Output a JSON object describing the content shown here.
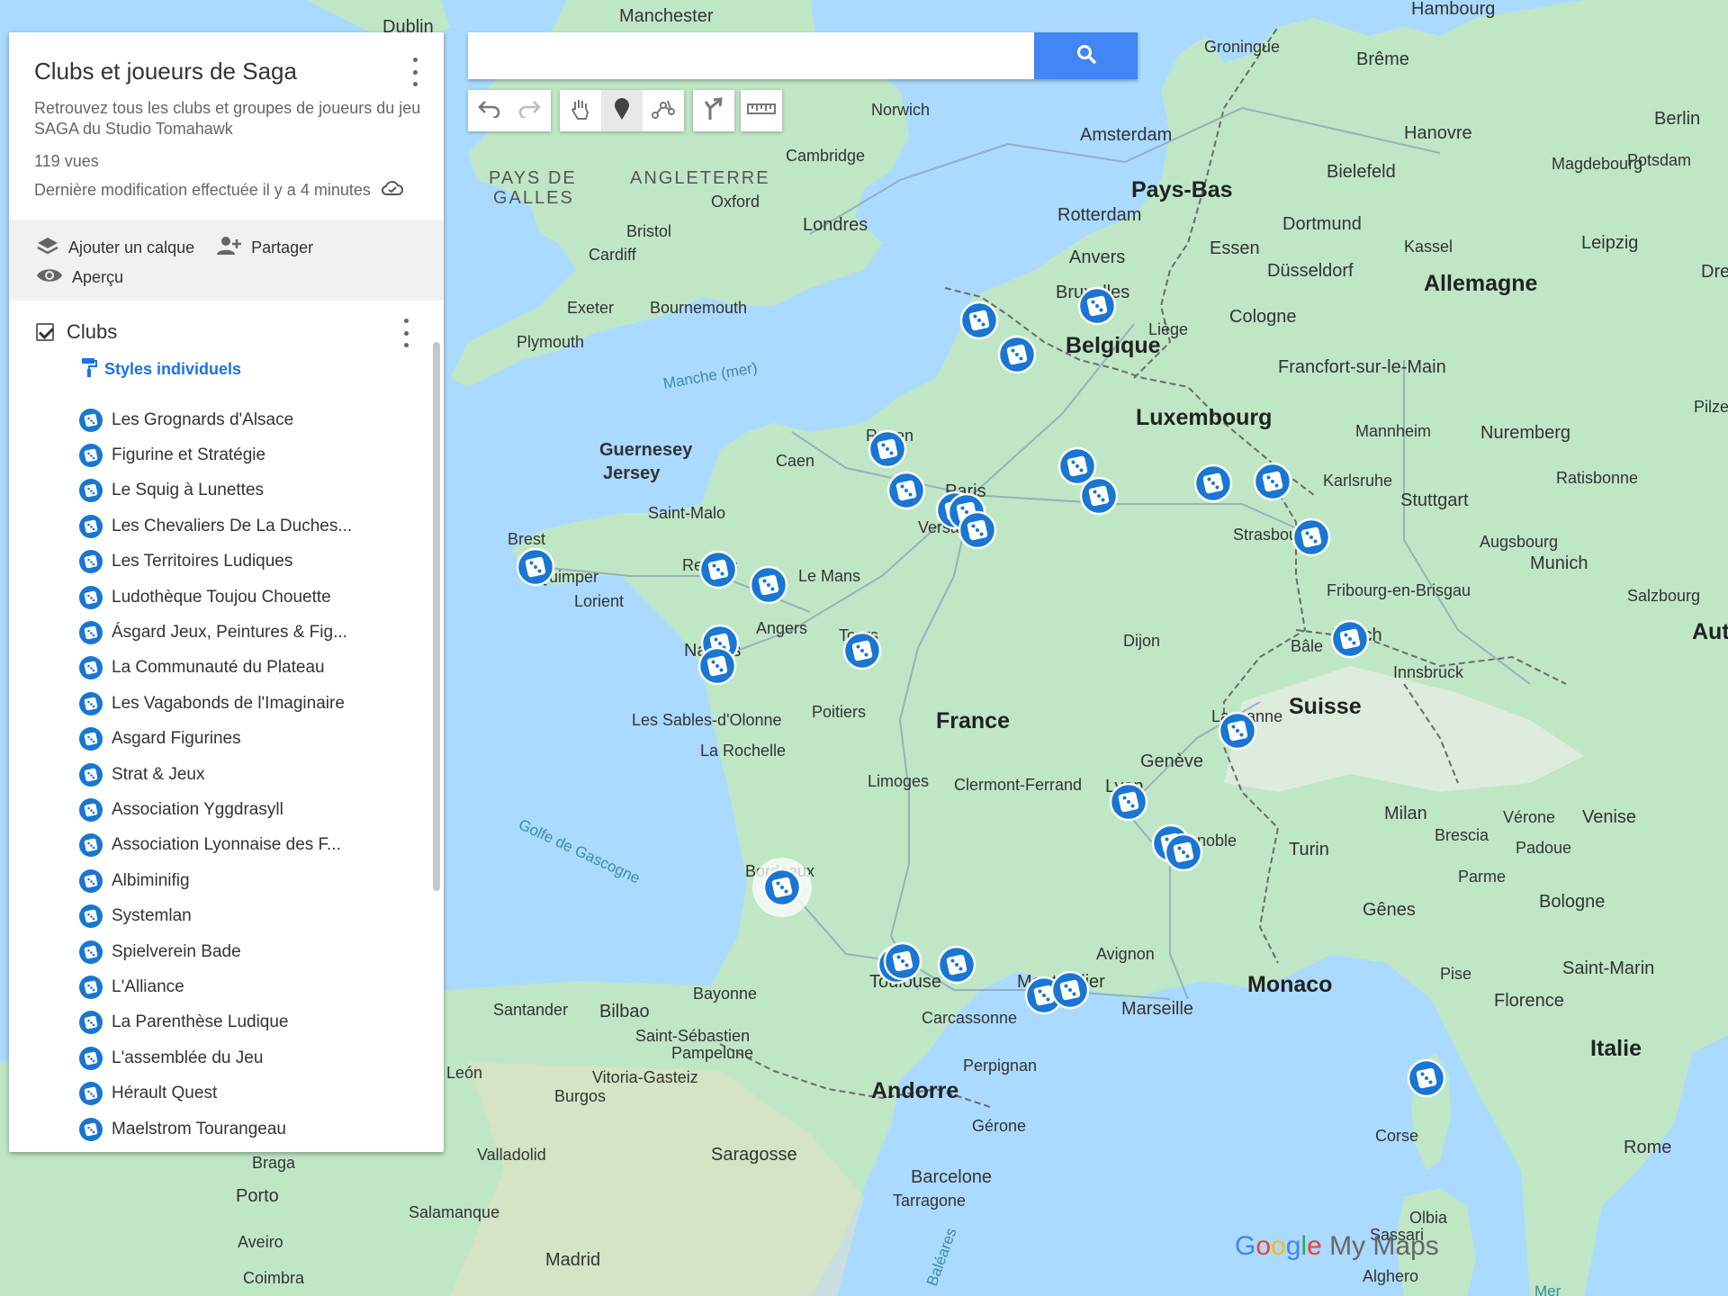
{
  "map_title": "Clubs et joueurs de Saga",
  "description": "Retrouvez tous les clubs et groupes de joueurs du jeu SAGA du Studio Tomahawk",
  "views": "119 vues",
  "last_modified": "Dernière modification effectuée il y a 4 minutes",
  "actions": {
    "add_layer": "Ajouter un calque",
    "share": "Partager",
    "preview": "Aperçu"
  },
  "layer": {
    "name": "Clubs",
    "style_link": "Styles individuels",
    "checked": true
  },
  "clubs": [
    "Les Grognards d'Alsace",
    "Figurine et Stratégie",
    "Le Squig à Lunettes",
    "Les Chevaliers De La Duches...",
    "Les Territoires Ludiques",
    "Ludothèque Toujou Chouette",
    "Ásgard Jeux, Peintures & Fig...",
    "La Communauté du Plateau",
    "Les Vagabonds de l'Imaginaire",
    "Asgard Figurines",
    "Strat & Jeux",
    "Association Yggdrasyll",
    "Association Lyonnaise des F...",
    "Albiminifig",
    "Systemlan",
    "Spielverein Bade",
    "L'Alliance",
    "La Parenthèse Ludique",
    "L'assemblée du Jeu",
    "Hérault Quest",
    "Maelstrom Tourangeau"
  ],
  "search": {
    "value": "",
    "placeholder": ""
  },
  "toolbar": [
    "undo-icon",
    "redo-icon",
    "hand-icon",
    "marker-icon",
    "draw-line-icon",
    "directions-icon",
    "ruler-icon"
  ],
  "branding": {
    "google": "Google",
    "my_maps": "My Maps"
  },
  "colors": {
    "land": "#bfe7c6",
    "sea": "#aadaff",
    "marker": "#1976d2",
    "search_button": "#4285f4",
    "accent_link": "#1a73e8"
  },
  "map_labels": {
    "countries": [
      "France",
      "Belgique",
      "Pays-Bas",
      "Allemagne",
      "Luxembourg",
      "Suisse",
      "Italie",
      "Andorre",
      "Monaco",
      "ANGLETERRE",
      "PAYS DE GALLES",
      "Autr"
    ],
    "cities": [
      "Manchester",
      "Dublin",
      "Hambourg",
      "Brême",
      "Groningue",
      "Norwich",
      "Cambridge",
      "Amsterdam",
      "Hanovre",
      "Berlin",
      "Bielefeld",
      "Magdebourg",
      "Potsdam",
      "Oxford",
      "Londres",
      "Bristol",
      "Cardiff",
      "Rotterdam",
      "Dortmund",
      "Essen",
      "Düsseldorf",
      "Kassel",
      "Leipzig",
      "Dresde",
      "Anvers",
      "Bruxelles",
      "Cologne",
      "Liège",
      "Exeter",
      "Bournemouth",
      "Plymouth",
      "Francfort-sur-le-Main",
      "Mannheim",
      "Nuremberg",
      "Karlsruhe",
      "Stuttgart",
      "Ratisbonne",
      "Pilzeñ",
      "Guernesey",
      "Jersey",
      "Caen",
      "Rouen",
      "Paris",
      "Versailles",
      "Saint-Malo",
      "Brest",
      "Quimper",
      "Lorient",
      "Rennes",
      "Le Mans",
      "Strasbourg",
      "Augsbourg",
      "Munich",
      "Fribourg-en-Brisgau",
      "Salzbourg",
      "Angers",
      "Nantes",
      "Tours",
      "Dijon",
      "Zurich",
      "Bâle",
      "Innsbruck",
      "Poitiers",
      "Les Sables-d'Olonne",
      "La Rochelle",
      "Limoges",
      "Clermont-Ferrand",
      "Lausanne",
      "Genève",
      "Lyon",
      "Milan",
      "Vérone",
      "Venise",
      "Brescia",
      "Padoue",
      "Turin",
      "Grenoble",
      "Bordeaux",
      "Parme",
      "Bologne",
      "Gênes",
      "Toulouse",
      "Avignon",
      "Montpellier",
      "Marseille",
      "Pise",
      "Florence",
      "Saint-Marin",
      "Bayonne",
      "Bilbao",
      "Santander",
      "Saint-Sébastien",
      "Pampelune",
      "Vitoria-Gasteiz",
      "Carcassonne",
      "Perpignan",
      "Burgos",
      "Gérone",
      "León",
      "Corse",
      "Rome",
      "Valladolid",
      "Saragosse",
      "Barcelone",
      "Tarragone",
      "Braga",
      "Porto",
      "Salamanque",
      "Aveiro",
      "Madrid",
      "Coimbra",
      "Olbia",
      "Sassari",
      "Alghero",
      "Baléares",
      "Mer"
    ],
    "water": [
      "Manche (mer)",
      "Golfe de Gascogne"
    ]
  }
}
